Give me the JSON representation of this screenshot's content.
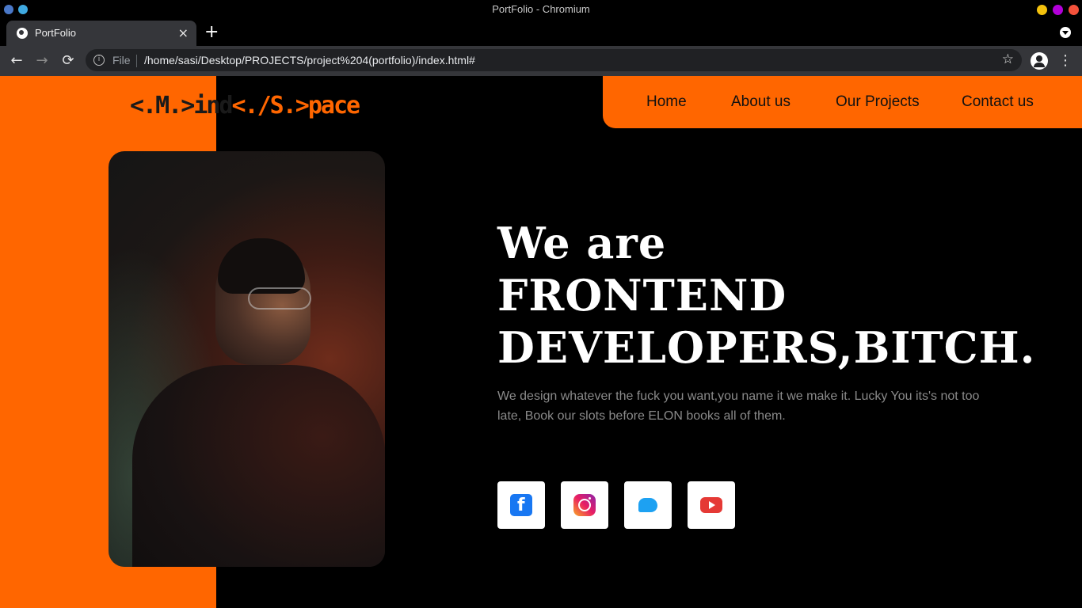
{
  "os": {
    "window_title": "PortFolio - Chromium",
    "colors": {
      "close": "#f4523b",
      "maximize": "#b300d9",
      "minimize": "#f4c20d"
    }
  },
  "browser": {
    "tab_title": "PortFolio",
    "tab_close": "×",
    "new_tab": "+",
    "back": "←",
    "forward": "→",
    "reload": "⟳",
    "info_icon": "i",
    "scheme_label": "File",
    "url": "/home/sasi/Desktop/PROJECTS/project%204(portfolio)/index.html#",
    "bookmark": "☆",
    "menu": "⋮"
  },
  "site": {
    "accent": "#ff6600",
    "logo": {
      "part1": "<.M.>",
      "part2": "ind",
      "part3": "<./S.>",
      "part4": "pace"
    },
    "nav": [
      "Home",
      "About us",
      "Our Projects",
      "Contact us"
    ],
    "hero": {
      "line1": "We are",
      "line2": "FRONTEND",
      "line3": "DEVELOPERS,BITCH."
    },
    "description": "We design whatever the fuck you want,you name it we make it. Lucky You its's not too late, Book our slots before ELON books all of them.",
    "social": [
      "facebook-icon",
      "instagram-icon",
      "twitter-icon",
      "youtube-icon"
    ]
  }
}
